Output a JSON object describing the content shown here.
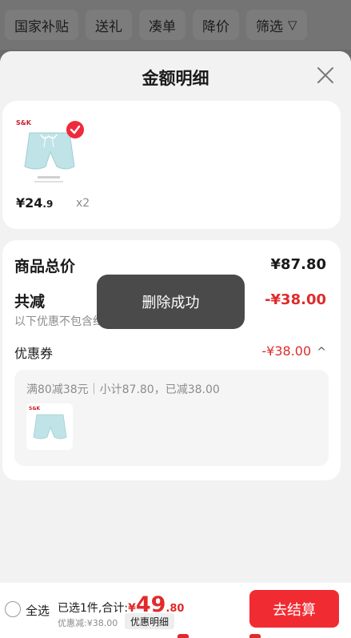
{
  "filters": {
    "chips": [
      "国家补贴",
      "送礼",
      "凑单",
      "降价"
    ],
    "filter_label": "筛选",
    "filter_icon": "▽"
  },
  "sheet": {
    "title": "金额明细",
    "close_icon": "close-icon"
  },
  "item": {
    "brand": "S&K",
    "price_main": "¥24",
    "price_dec": ".9",
    "qty": "x2",
    "checked": true
  },
  "summary": {
    "total_label": "商品总价",
    "total_value": "¥87.80",
    "reduce_label": "共减",
    "reduce_value": "-¥38.00",
    "note": "以下优惠不包含红包，请在结算页查看",
    "coupon_label": "优惠券",
    "coupon_value": "-¥38.00",
    "coupon_chevron": "^",
    "coupon_desc": "满80减38元｜小计87.80，已减38.00"
  },
  "toast": {
    "text": "删除成功"
  },
  "bottom": {
    "select_all": "全选",
    "selected_prefix": "已选1件,合计:",
    "currency": "¥",
    "total_int": "49",
    "total_dec": ".80",
    "discount": "优惠减:¥38.00",
    "detail_label": "优惠明细",
    "checkout_label": "去结算"
  },
  "colors": {
    "accent_red": "#e02b2b",
    "button_red": "#f02c32",
    "toast_bg": "#4a4a4a"
  }
}
